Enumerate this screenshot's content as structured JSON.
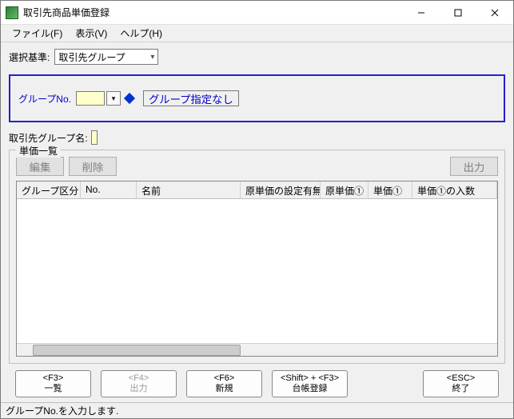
{
  "window": {
    "title": "取引先商品単価登録"
  },
  "menu": {
    "file": "ファイル(F)",
    "view": "表示(V)",
    "help": "ヘルプ(H)"
  },
  "criteria": {
    "label": "選択基準:",
    "value": "取引先グループ"
  },
  "group": {
    "no_label": "グループNo.",
    "no_value": "",
    "none_button": "グループ指定なし",
    "name_label": "取引先グループ名:",
    "name_value": ""
  },
  "list": {
    "legend": "単価一覧",
    "buttons": {
      "edit": "編集",
      "delete": "削除",
      "output": "出力"
    },
    "columns": [
      "グループ区分",
      "No.",
      "名前",
      "原単価の設定有無",
      "原単価①",
      "単価①",
      "単価①の入数"
    ]
  },
  "fkeys": {
    "f3": {
      "key": "<F3>",
      "label": "一覧"
    },
    "f4": {
      "key": "<F4>",
      "label": "出力"
    },
    "f6": {
      "key": "<F6>",
      "label": "新規"
    },
    "shiftf3": {
      "key": "<Shift> + <F3>",
      "label": "台帳登録"
    },
    "esc": {
      "key": "<ESC>",
      "label": "終了"
    }
  },
  "status": "グループNo.を入力します."
}
